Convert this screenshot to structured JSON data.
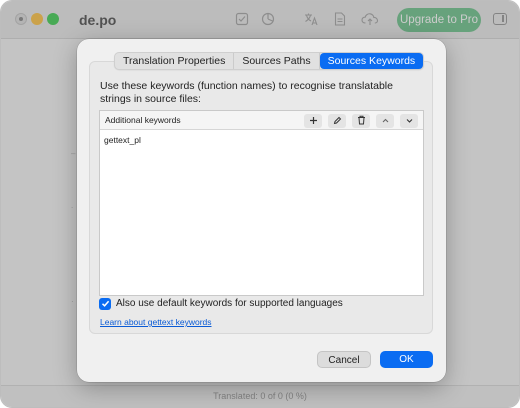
{
  "window": {
    "title": "de.po",
    "upgrade_label": "Upgrade to Pro",
    "status": "Translated: 0 of 0 (0 %)"
  },
  "dialog": {
    "tabs": [
      {
        "label": "Translation Properties",
        "active": false
      },
      {
        "label": "Sources Paths",
        "active": false
      },
      {
        "label": "Sources Keywords",
        "active": true
      }
    ],
    "description": "Use these keywords (function names) to recognise translatable strings in source files:",
    "keywords_header": "Additional keywords",
    "keywords": [
      "gettext_pl"
    ],
    "toolbar_icons": [
      "plus-icon",
      "pencil-icon",
      "trash-icon",
      "chevron-up-icon",
      "chevron-down-icon"
    ],
    "use_default_label": "Also use default keywords for supported languages",
    "use_default_checked": true,
    "learn_link": "Learn about gettext keywords",
    "cancel_label": "Cancel",
    "ok_label": "OK"
  },
  "colors": {
    "accent": "#0a6cf2",
    "upgrade": "#5dbb7e"
  }
}
